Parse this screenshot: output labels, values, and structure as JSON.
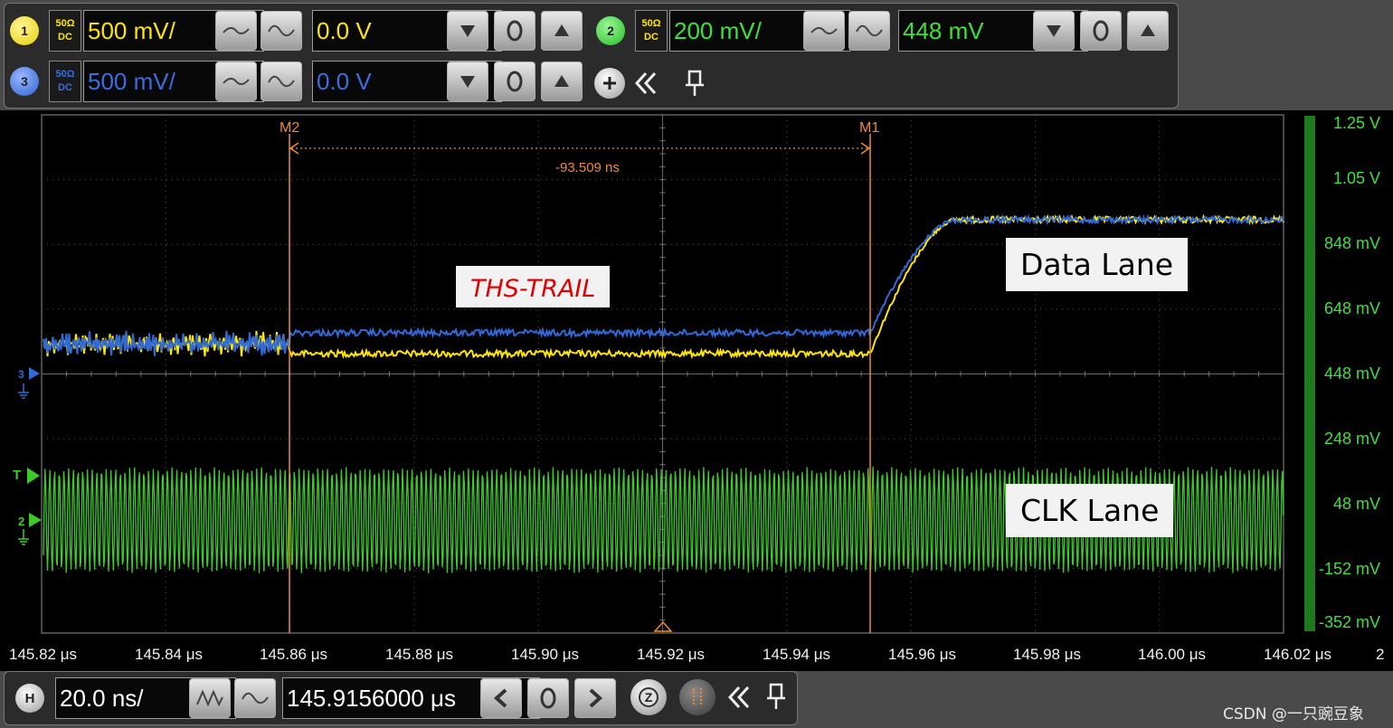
{
  "channels": {
    "ch1": {
      "number": "1",
      "impedance": "50Ω",
      "coupling": "DC",
      "scale": "500 mV/",
      "offset": "0.0 V",
      "color": "#ffe600"
    },
    "ch2": {
      "number": "2",
      "impedance": "50Ω",
      "coupling": "DC",
      "scale": "200 mV/",
      "offset": "448 mV",
      "color": "#3ee03e"
    },
    "ch3": {
      "number": "3",
      "impedance": "50Ω",
      "coupling": "DC",
      "scale": "500 mV/",
      "offset": "0.0 V",
      "color": "#3a6de0"
    }
  },
  "icons": {
    "waveform_buttons": [
      "low-freq-wave-icon",
      "high-freq-wave-icon"
    ],
    "offset_buttons": [
      "arrow-down-icon",
      "zero-icon",
      "arrow-up-icon"
    ],
    "toolbar": [
      "add-channel-icon",
      "collapse-icon",
      "pin-icon"
    ],
    "horizontal": [
      "h-icon",
      "timebase-wave-icon",
      "arrow-left-icon",
      "zero-icon",
      "arrow-right-icon",
      "zoom-icon",
      "grid-icon",
      "collapse-icon",
      "pin-icon"
    ]
  },
  "markers": {
    "m1": "M1",
    "m2": "M2",
    "delta": "-93.509 ns"
  },
  "annotations": {
    "ths_trail": "THS-TRAIL",
    "data_lane": "Data Lane",
    "clk_lane": "CLK Lane"
  },
  "y_axis_labels": [
    "1.25 V",
    "1.05 V",
    "848 mV",
    "648 mV",
    "448 mV",
    "248 mV",
    "48 mV",
    "-152 mV",
    "-352 mV"
  ],
  "x_axis_labels": [
    "145.82 μs",
    "145.84 μs",
    "145.86 μs",
    "145.88 μs",
    "145.90 μs",
    "145.92 μs",
    "145.94 μs",
    "145.96 μs",
    "145.98 μs",
    "146.00 μs",
    "146.02 μs"
  ],
  "x_axis_suffix": "2",
  "ground_markers": {
    "ch3": "3",
    "trigger": "T",
    "ch2": "2"
  },
  "horizontal": {
    "badge": "H",
    "timebase": "20.0 ns/",
    "position": "145.9156000 μs"
  },
  "watermark": "CSDN @一只豌豆象",
  "colors": {
    "data_lane_yellow": "#ffe600",
    "data_lane_blue": "#2f6ad8",
    "clk_green": "#3ccc2a",
    "marker_orange": "#f08a30",
    "ths_trail_red": "#e00000"
  }
}
